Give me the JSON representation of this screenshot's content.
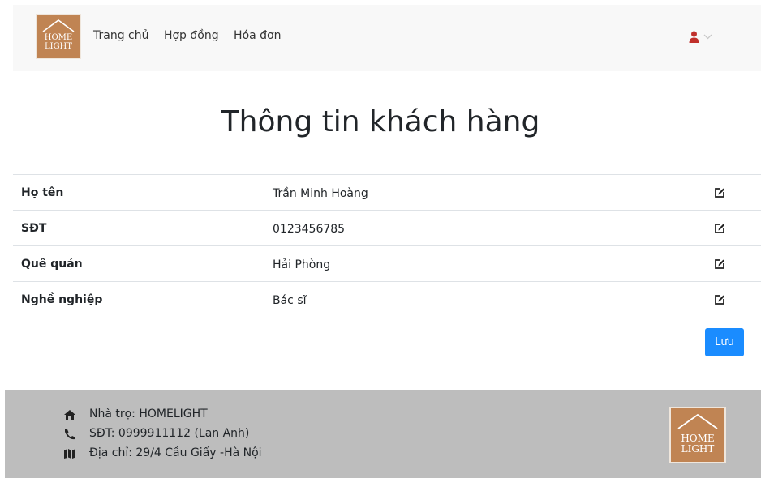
{
  "navbar": {
    "logo_line1": "HOME",
    "logo_line2": "LIGHT",
    "links": [
      "Trang chủ",
      "Hợp đồng",
      "Hóa đơn"
    ]
  },
  "page_title": "Thông tin khách hàng",
  "customer_rows": [
    {
      "label": "Họ tên",
      "value": "Trần Minh Hoàng"
    },
    {
      "label": "SĐT",
      "value": "0123456785"
    },
    {
      "label": "Quê quán",
      "value": "Hải Phòng"
    },
    {
      "label": "Nghề nghiệp",
      "value": "Bác sĩ"
    }
  ],
  "save_label": "Lưu",
  "footer": {
    "name": "Nhà trọ: HOMELIGHT",
    "phone": "SĐT: 0999911112 (Lan Anh)",
    "address": "Địa chỉ: 29/4 Cầu Giấy -Hà Nội",
    "logo_line1": "HOME",
    "logo_line2": "LIGHT"
  },
  "colors": {
    "brand": "#c08453",
    "primary_button": "#1a8cff",
    "user_icon": "#c0302b",
    "footer_bg": "#bdbdbd",
    "navbar_bg": "#f8f8f8"
  },
  "icons": [
    "home-logo",
    "user-icon",
    "chevron-down-icon",
    "edit-icon",
    "home-icon",
    "phone-icon",
    "map-icon"
  ]
}
